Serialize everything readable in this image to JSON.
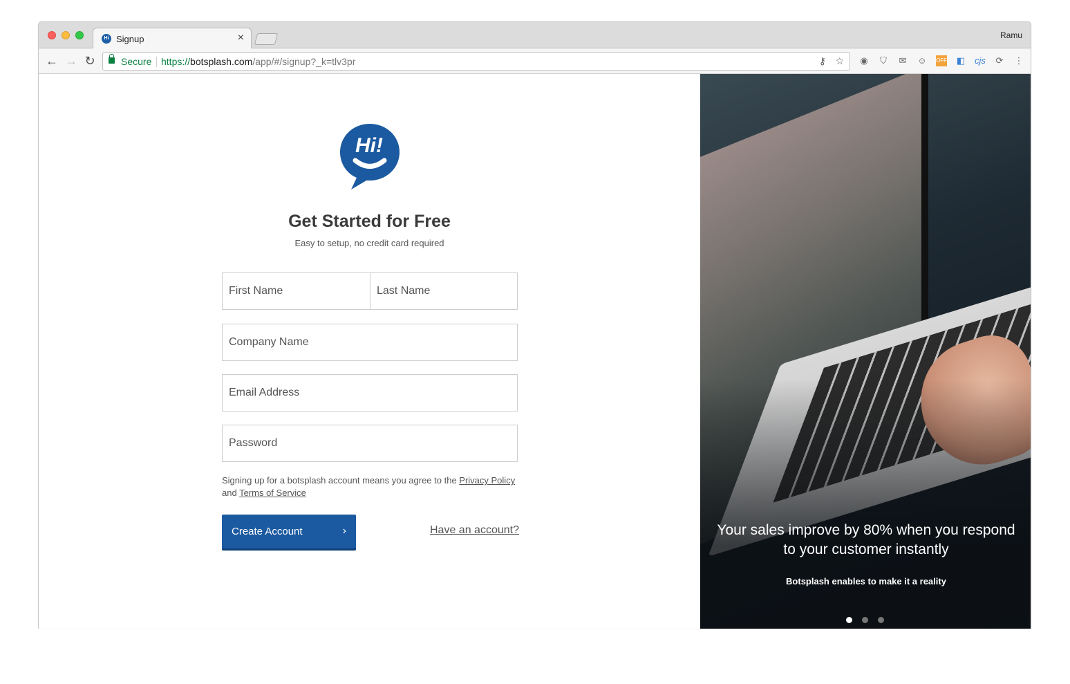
{
  "browser": {
    "tab_title": "Signup",
    "tab_close": "×",
    "profile_name": "Ramu",
    "secure_label": "Secure",
    "url_scheme": "https://",
    "url_host": "botsplash.com",
    "url_path": "/app/#/signup?_k=tlv3pr"
  },
  "page": {
    "logo_text": "Hi!",
    "heading": "Get Started for Free",
    "subheading": "Easy to setup, no credit card required",
    "fields": {
      "first_name": "First Name",
      "last_name": "Last Name",
      "company": "Company Name",
      "email": "Email Address",
      "password": "Password"
    },
    "terms_prefix": "Signing up for a botsplash account means you agree to the ",
    "privacy_link": "Privacy Policy",
    "terms_and": " and ",
    "tos_link": "Terms of Service",
    "create_button": "Create Account",
    "have_account": "Have an account?"
  },
  "hero": {
    "title": "Your sales improve by 80% when you respond to your customer instantly",
    "subtitle": "Botsplash enables to make it a reality",
    "slides": 3,
    "active_slide": 1
  },
  "colors": {
    "brand_blue": "#1b5aa0",
    "secure_green": "#0b8043"
  }
}
